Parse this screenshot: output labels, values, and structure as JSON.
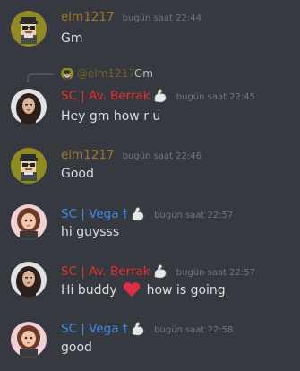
{
  "messages": [
    {
      "author": "elm1217",
      "time": "bugün saat 22:44",
      "text": "Gm"
    },
    {
      "reply_to": {
        "author": "@elm1217",
        "text": "Gm"
      },
      "author": "SC | Av. Berrak",
      "time": "bugün saat 22:45",
      "text": "Hey gm how r u"
    },
    {
      "author": "elm1217",
      "time": "bugün saat 22:46",
      "text": "Good"
    },
    {
      "author": "SC | Vega",
      "cross": "†",
      "time": "bugün saat 22:57",
      "text": "hi guysss"
    },
    {
      "author": "SC | Av. Berrak",
      "time": "bugün saat 22:57",
      "text_before": "Hi buddy",
      "text_after": "how is going"
    },
    {
      "author": "SC | Vega",
      "cross": "†",
      "time": "bugün saat 22:58",
      "text": "good"
    }
  ],
  "colors": {
    "background": "#36393f",
    "elm1217": "#a0772a",
    "berrak": "#e33030",
    "vega": "#3d8be8",
    "timestamp": "#72767d",
    "message_text": "#dcddde"
  },
  "icons": {
    "elm1217_avatar": "pixel-character-avatar-icon",
    "berrak_avatar": "profile-photo-avatar-icon",
    "vega_avatar": "cartoon-girl-avatar-icon",
    "role_badge": "flexed-biceps-icon",
    "emoji_heart": "red-heart-icon"
  }
}
